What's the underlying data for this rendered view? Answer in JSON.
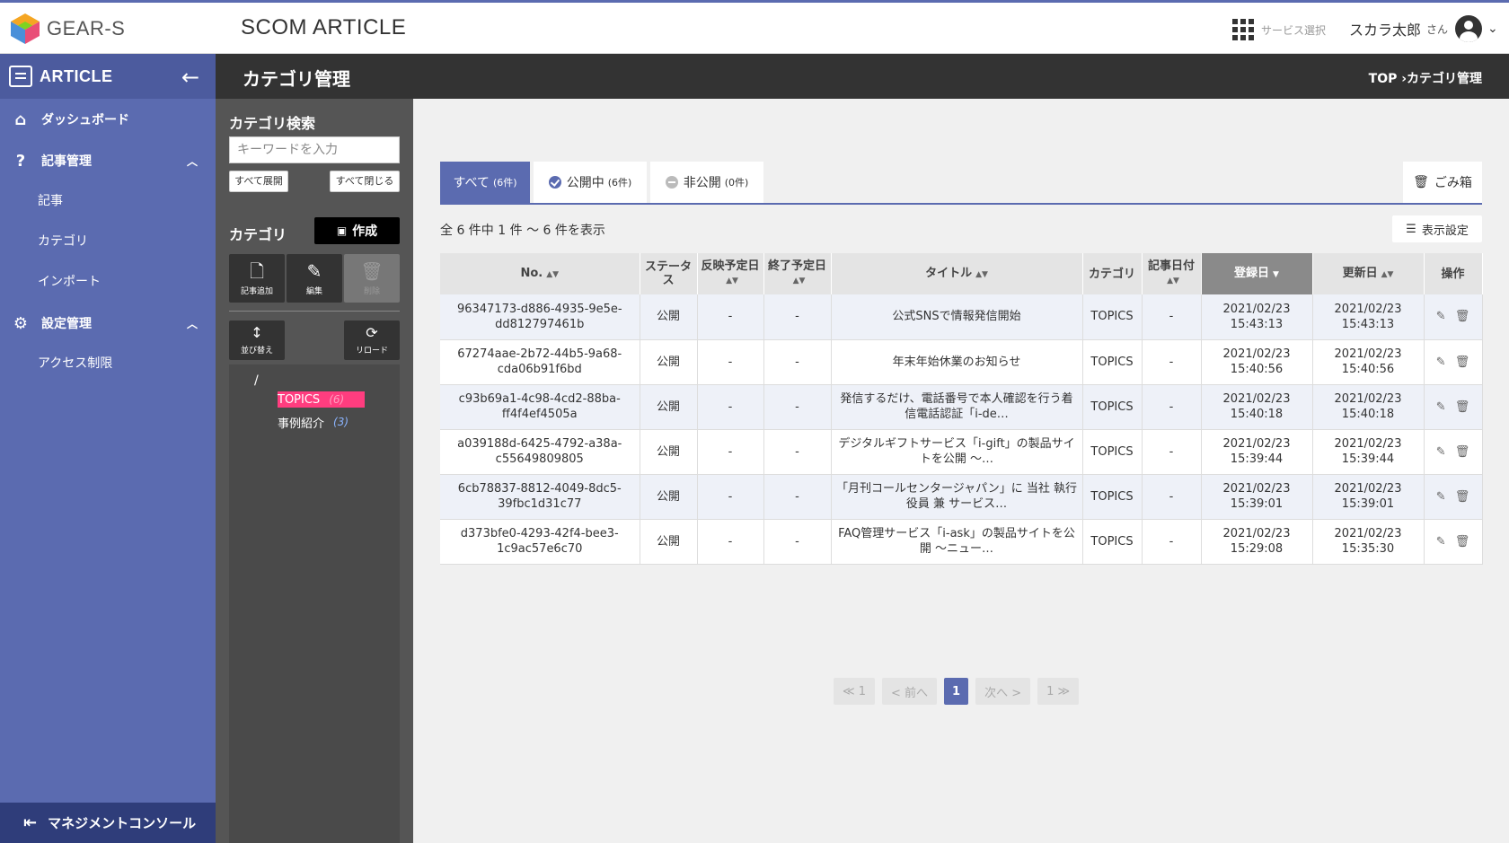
{
  "header": {
    "logo_text": "GEAR-S",
    "app_title": "SCOM ARTICLE",
    "service_select": "サービス選択",
    "user_name": "スカラ太郎",
    "user_honorific": "さん"
  },
  "sidebar": {
    "title": "ARTICLE",
    "items": [
      {
        "label": "ダッシュボード",
        "icon": "home-icon"
      },
      {
        "label": "記事管理",
        "icon": "question-icon"
      },
      {
        "label": "記事"
      },
      {
        "label": "カテゴリ"
      },
      {
        "label": "インポート"
      },
      {
        "label": "設定管理",
        "icon": "gear-icon"
      },
      {
        "label": "アクセス制限"
      }
    ],
    "footer": "マネジメントコンソール"
  },
  "pagebar": {
    "title": "カテゴリ管理",
    "breadcrumb": "TOP ›カテゴリ管理"
  },
  "category_panel": {
    "search_label": "カテゴリ検索",
    "search_placeholder": "キーワードを入力",
    "expand_all": "すべて展開",
    "collapse_all": "すべて閉じる",
    "category_label": "カテゴリ",
    "create_label": "作成",
    "add_label": "記事追加",
    "edit_label": "編集",
    "delete_label": "削除",
    "sort_label": "並び替え",
    "reload_label": "リロード",
    "tree_root": "/",
    "tree": [
      {
        "name": "TOPICS",
        "count": "(6)"
      },
      {
        "name": "事例紹介",
        "count": "(3)"
      }
    ]
  },
  "tabs": [
    {
      "label": "すべて",
      "count": "(6件)"
    },
    {
      "label": "公開中",
      "count": "(6件)"
    },
    {
      "label": "非公開",
      "count": "(0件)"
    }
  ],
  "trash_label": "ごみ箱",
  "count_text": "全 6 件中 1 件 〜 6 件を表示",
  "display_settings": "表示設定",
  "table": {
    "headers": {
      "no": "No.",
      "status": "ステータス",
      "publish_date": "反映予定日",
      "end_date": "終了予定日",
      "title": "タイトル",
      "category": "カテゴリ",
      "article_date": "記事日付",
      "registered": "登録日",
      "updated": "更新日",
      "ops": "操作"
    },
    "rows": [
      {
        "no": "96347173-d886-4935-9e5e-dd812797461b",
        "status": "公開",
        "publish": "-",
        "end": "-",
        "title": "公式SNSで情報発信開始",
        "category": "TOPICS",
        "article_date": "-",
        "registered": "2021/02/23 15:43:13",
        "updated": "2021/02/23 15:43:13"
      },
      {
        "no": "67274aae-2b72-44b5-9a68-cda06b91f6bd",
        "status": "公開",
        "publish": "-",
        "end": "-",
        "title": "年末年始休業のお知らせ",
        "category": "TOPICS",
        "article_date": "-",
        "registered": "2021/02/23 15:40:56",
        "updated": "2021/02/23 15:40:56"
      },
      {
        "no": "c93b69a1-4c98-4cd2-88ba-ff4f4ef4505a",
        "status": "公開",
        "publish": "-",
        "end": "-",
        "title": "発信するだけ、電話番号で本人確認を行う着信電話認証「i-de…",
        "category": "TOPICS",
        "article_date": "-",
        "registered": "2021/02/23 15:40:18",
        "updated": "2021/02/23 15:40:18"
      },
      {
        "no": "a039188d-6425-4792-a38a-c55649809805",
        "status": "公開",
        "publish": "-",
        "end": "-",
        "title": "デジタルギフトサービス「i-gift」の製品サイトを公開 〜…",
        "category": "TOPICS",
        "article_date": "-",
        "registered": "2021/02/23 15:39:44",
        "updated": "2021/02/23 15:39:44"
      },
      {
        "no": "6cb78837-8812-4049-8dc5-39fbc1d31c77",
        "status": "公開",
        "publish": "-",
        "end": "-",
        "title": "「月刊コールセンタージャパン」に 当社 執行役員 兼 サービス…",
        "category": "TOPICS",
        "article_date": "-",
        "registered": "2021/02/23 15:39:01",
        "updated": "2021/02/23 15:39:01"
      },
      {
        "no": "d373bfe0-4293-42f4-bee3-1c9ac57e6c70",
        "status": "公開",
        "publish": "-",
        "end": "-",
        "title": "FAQ管理サービス「i-ask」の製品サイトを公開 〜ニュー…",
        "category": "TOPICS",
        "article_date": "-",
        "registered": "2021/02/23 15:29:08",
        "updated": "2021/02/23 15:35:30"
      }
    ]
  },
  "pager": {
    "first": "≪ 1",
    "prev": "< 前へ",
    "current": "1",
    "next": "次へ >",
    "last": "1 ≫"
  },
  "colors": {
    "accent": "#5b6bb0",
    "sidebar_footer": "#2f3d7a",
    "dark_bar": "#333333",
    "tree_selected": "#ff3d7f"
  }
}
